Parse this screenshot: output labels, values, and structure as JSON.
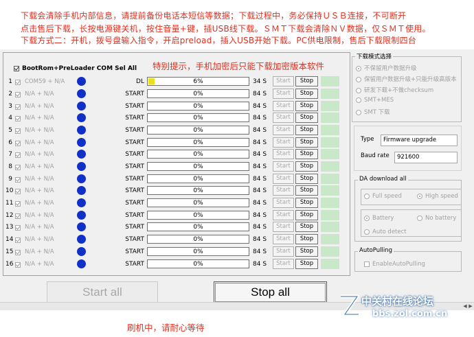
{
  "notice": {
    "line1": "下载会清除手机内部信息，请提前备份电话本短信等数据；下载过程中，务必保持ＵＳＢ连接，不可断开",
    "line2": "点击售后下载，长按电源键关机，按住音量+键，插USB线下载。ＳＭＴ下载会清除ＮＶ数据，仅ＳＭＴ使用。",
    "line3": "下载方式二：开机，拨号盘输入指令，开启preload，插入USB开始下载。PC供电限制，售后下载限制四台"
  },
  "tip": "特别提示，手机加密后只能下载加密版本软件",
  "select_all_label": "BootRom+PreLoader COM Sel All",
  "rows": [
    {
      "num": "1",
      "port": "COM59 + N/A",
      "status": "DL",
      "progress": "6%",
      "progress_value": 0.06,
      "speed": "34 S",
      "start": "Start",
      "stop": "Stop"
    },
    {
      "num": "2",
      "port": "N/A + N/A",
      "status": "START",
      "progress": "0%",
      "progress_value": 0,
      "speed": "84 S",
      "start": "Start",
      "stop": "Stop"
    },
    {
      "num": "3",
      "port": "N/A + N/A",
      "status": "START",
      "progress": "0%",
      "progress_value": 0,
      "speed": "84 S",
      "start": "Start",
      "stop": "Stop"
    },
    {
      "num": "4",
      "port": "N/A + N/A",
      "status": "START",
      "progress": "0%",
      "progress_value": 0,
      "speed": "84 S",
      "start": "Start",
      "stop": "Stop"
    },
    {
      "num": "5",
      "port": "N/A + N/A",
      "status": "START",
      "progress": "0%",
      "progress_value": 0,
      "speed": "84 S",
      "start": "Start",
      "stop": "Stop"
    },
    {
      "num": "6",
      "port": "N/A + N/A",
      "status": "START",
      "progress": "0%",
      "progress_value": 0,
      "speed": "84 S",
      "start": "Start",
      "stop": "Stop"
    },
    {
      "num": "7",
      "port": "N/A + N/A",
      "status": "START",
      "progress": "0%",
      "progress_value": 0,
      "speed": "84 S",
      "start": "Start",
      "stop": "Stop"
    },
    {
      "num": "8",
      "port": "N/A + N/A",
      "status": "START",
      "progress": "0%",
      "progress_value": 0,
      "speed": "84 S",
      "start": "Start",
      "stop": "Stop"
    },
    {
      "num": "9",
      "port": "N/A + N/A",
      "status": "START",
      "progress": "0%",
      "progress_value": 0,
      "speed": "84 S",
      "start": "Start",
      "stop": "Stop"
    },
    {
      "num": "10",
      "port": "N/A + N/A",
      "status": "START",
      "progress": "0%",
      "progress_value": 0,
      "speed": "84 S",
      "start": "Start",
      "stop": "Stop"
    },
    {
      "num": "11",
      "port": "N/A + N/A",
      "status": "START",
      "progress": "0%",
      "progress_value": 0,
      "speed": "84 S",
      "start": "Start",
      "stop": "Stop"
    },
    {
      "num": "12",
      "port": "N/A + N/A",
      "status": "START",
      "progress": "0%",
      "progress_value": 0,
      "speed": "84 S",
      "start": "Start",
      "stop": "Stop"
    },
    {
      "num": "13",
      "port": "N/A + N/A",
      "status": "START",
      "progress": "0%",
      "progress_value": 0,
      "speed": "84 S",
      "start": "Start",
      "stop": "Stop"
    },
    {
      "num": "14",
      "port": "N/A + N/A",
      "status": "START",
      "progress": "0%",
      "progress_value": 0,
      "speed": "84 S",
      "start": "Start",
      "stop": "Stop"
    },
    {
      "num": "15",
      "port": "N/A + N/A",
      "status": "START",
      "progress": "0%",
      "progress_value": 0,
      "speed": "84 S",
      "start": "Start",
      "stop": "Stop"
    },
    {
      "num": "16",
      "port": "N/A + N/A",
      "status": "START",
      "progress": "0%",
      "progress_value": 0,
      "speed": "84 S",
      "start": "Start",
      "stop": "Stop"
    }
  ],
  "buttons": {
    "start_all": "Start all",
    "stop_all": "Stop all"
  },
  "busy_text": "刷机中，请耐心等待",
  "download_mode": {
    "title": "下载模式选择",
    "options": [
      "不保留用户数据升级",
      "保留用户数据升级+只能升级高版本",
      "研发下载+不做checksum",
      "SMT+MES",
      "SMT 下载"
    ],
    "selected_index": 0
  },
  "type_label": "Type",
  "type_value": "Firmware upgrade",
  "baud_label": "Baud rate",
  "baud_value": "921600",
  "da_download": {
    "title": "DA download all",
    "speed_options": [
      "Full speed",
      "High speed"
    ],
    "speed_selected_index": 1,
    "power_options": [
      "Battery",
      "No battery"
    ],
    "power_selected_index": 0,
    "auto_detect": "Auto detect"
  },
  "autopulling": {
    "title": "AutoPulling",
    "checkbox_label": "EnableAutoPulling"
  },
  "watermark": {
    "line1": "中关村在线论坛",
    "line2": "bbs.zol.com.cn"
  },
  "colors": {
    "notice_red": "#e03020",
    "dot_blue": "#1030c8",
    "progress_fill": "#e8e020",
    "status_green": "#c8e8c8"
  }
}
